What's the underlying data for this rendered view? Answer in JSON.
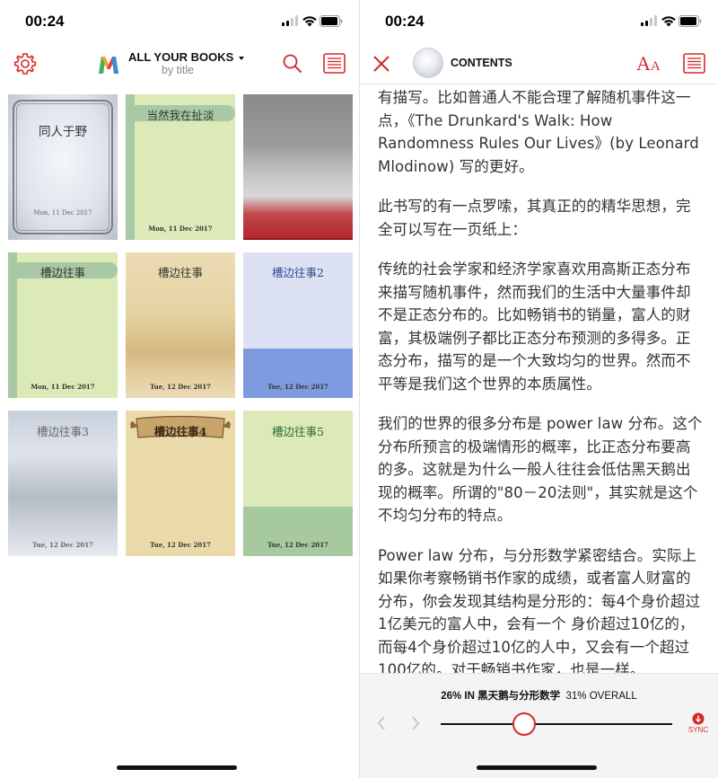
{
  "status_bar": {
    "time_left": "00:24",
    "time_right": "00:24"
  },
  "library": {
    "header_title": "ALL YOUR BOOKS",
    "header_subtitle": "by title",
    "books": [
      {
        "title": "同人于野",
        "date": "Mon, 11 Dec 2017"
      },
      {
        "title": "当然我在扯淡",
        "date": "Mon, 11 Dec 2017"
      },
      {
        "title": "",
        "date": ""
      },
      {
        "title": "槽边往事",
        "date": "Mon, 11 Dec 2017"
      },
      {
        "title": "槽边往事",
        "date": "Tue, 12 Dec 2017"
      },
      {
        "title": "槽边往事2",
        "date": "Tue, 12 Dec 2017"
      },
      {
        "title": "槽边往事3",
        "date": "Tue, 12 Dec 2017"
      },
      {
        "title": "槽边往事4",
        "date": "Tue, 12 Dec 2017"
      },
      {
        "title": "槽边往事5",
        "date": "Tue, 12 Dec 2017"
      }
    ]
  },
  "reader": {
    "header_title": "CONTENTS",
    "font_button_label": "A",
    "font_button_label_small": "A",
    "paragraphs": [
      "有描写。比如普通人不能合理了解随机事件这一点，《The Drunkard's Walk: How Randomness Rules Our Lives》(by Leonard Mlodinow) 写的更好。",
      "此书写的有一点罗嗦，其真正的的精华思想，完全可以写在一页纸上：",
      "传统的社会学家和经济学家喜欢用高斯正态分布来描写随机事件，然而我们的生活中大量事件却不是正态分布的。比如畅销书的销量，富人的财富，其极端例子都比正态分布预测的多得多。正态分布，描写的是一个大致均匀的世界。然而不平等是我们这个世界的本质属性。",
      "我们的世界的很多分布是 power law 分布。这个分布所预言的极端情形的概率，比正态分布要高的多。这就是为什么一般人往往会低估黑天鹅出现的概率。所谓的\"80－20法则\"，其实就是这个不均匀分布的特点。",
      "Power law 分布，与分形数学紧密结合。实际上如果你考察畅销书作家的成绩，或者富人财富的分布，你会发现其结构是分形的：每4个身价超过1亿美元的富人中，会有一个 身价超过10亿的，而每4个身价超过10亿的人中，又会有一个超过100亿的。对于畅销书作家，也是一样。"
    ],
    "progress_percent": "26% IN",
    "chapter": "黑天鹅与分形数学",
    "overall": "31% OVERALL",
    "sync_label": "SYNC",
    "slider_position": 0.36
  },
  "colors": {
    "accent": "#d6282a"
  }
}
